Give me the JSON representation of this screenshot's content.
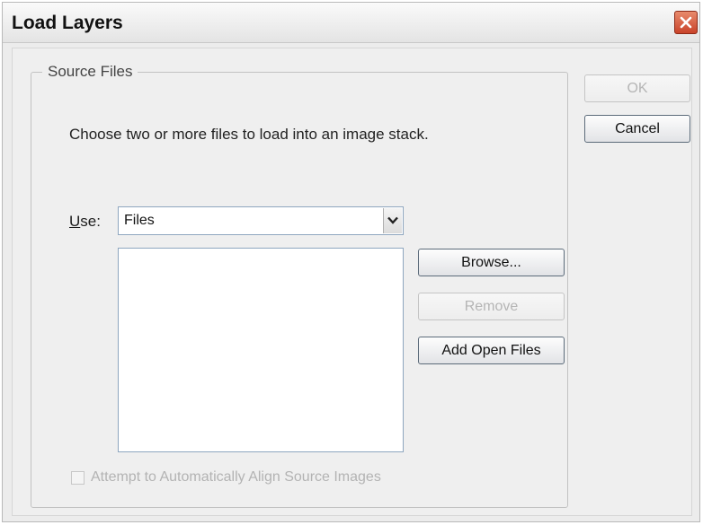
{
  "window": {
    "title": "Load Layers",
    "close_icon": "close-icon"
  },
  "source_files": {
    "legend": "Source Files",
    "description": "Choose two or more files to load into an image stack.",
    "use_label": "Use:",
    "use_accesskey": "U",
    "use_label_rest": "se:",
    "use_value": "Files",
    "file_list": []
  },
  "buttons": {
    "browse": "Browse...",
    "remove": "Remove",
    "add_open_files": "Add Open Files",
    "ok": "OK",
    "cancel": "Cancel"
  },
  "align_checkbox": {
    "label": "Attempt to Automatically Align Source Images",
    "checked": false,
    "enabled": false
  },
  "colors": {
    "close_button": "#c9432a",
    "border_accent": "#8ea6bf",
    "disabled_text": "#b5b5b5"
  }
}
